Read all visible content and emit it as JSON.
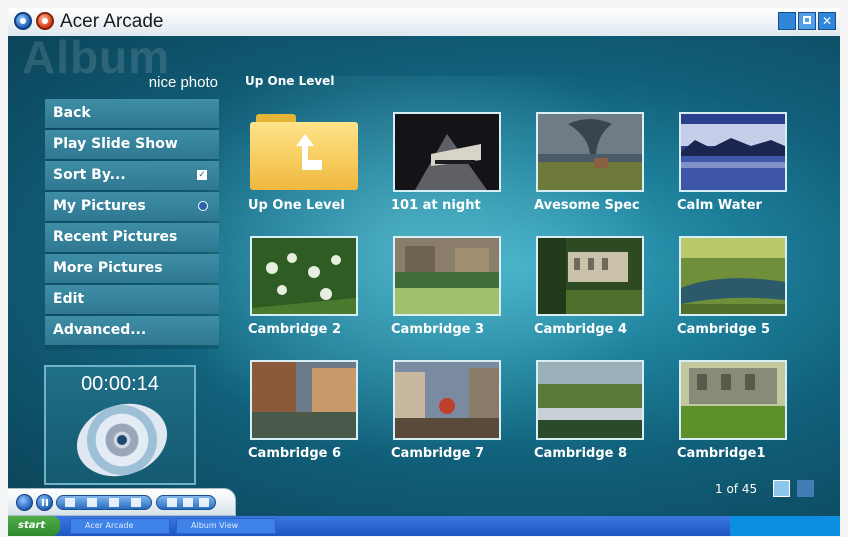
{
  "window": {
    "title": "Acer Arcade",
    "controls": [
      "minimize",
      "restore",
      "close"
    ]
  },
  "section_background_label": "Album",
  "album_name": "nice photo",
  "breadcrumb": "Up One Level",
  "menu": [
    {
      "label": "Back"
    },
    {
      "label": "Play Slide Show"
    },
    {
      "label": "Sort By...",
      "indicator": "checkbox"
    },
    {
      "label": "My Pictures",
      "indicator": "radio"
    },
    {
      "label": "Recent Pictures"
    },
    {
      "label": "More Pictures"
    },
    {
      "label": "Edit"
    },
    {
      "label": "Advanced..."
    }
  ],
  "player": {
    "time": "00:00:14"
  },
  "grid": [
    {
      "label": "Up One Level",
      "kind": "folder"
    },
    {
      "label": "101 at night",
      "kind": "photo",
      "colors": [
        "#1b1b22",
        "#6b6b70",
        "#d9d4c8"
      ]
    },
    {
      "label": "Avesome Spec",
      "kind": "photo",
      "colors": [
        "#4a5a66",
        "#8d9aa0",
        "#6d7a3c"
      ]
    },
    {
      "label": "Calm Water",
      "kind": "photo",
      "colors": [
        "#2b3f8c",
        "#c6cde8",
        "#2a3a6a"
      ]
    },
    {
      "label": "Cambridge 2",
      "kind": "photo",
      "colors": [
        "#2f5c22",
        "#e8eee0",
        "#4a7a2e"
      ]
    },
    {
      "label": "Cambridge 3",
      "kind": "photo",
      "colors": [
        "#8a7e6a",
        "#3f6e3a",
        "#b9c79a"
      ]
    },
    {
      "label": "Cambridge 4",
      "kind": "photo",
      "colors": [
        "#2d4a22",
        "#c9c2a8",
        "#4e6e2e"
      ]
    },
    {
      "label": "Cambridge 5",
      "kind": "photo",
      "colors": [
        "#6f8f3a",
        "#b8c86a",
        "#2d5a6a"
      ]
    },
    {
      "label": "Cambridge 6",
      "kind": "photo",
      "colors": [
        "#8a5a3a",
        "#6e7a8a",
        "#c89a6a"
      ]
    },
    {
      "label": "Cambridge 7",
      "kind": "photo",
      "colors": [
        "#7a8aa0",
        "#5a4a3a",
        "#c8b8a0"
      ]
    },
    {
      "label": "Cambridge 8",
      "kind": "photo",
      "colors": [
        "#5a7a3a",
        "#9ab0b8",
        "#2a4a2a"
      ]
    },
    {
      "label": "Cambridge1",
      "kind": "photo",
      "colors": [
        "#8a8a78",
        "#c2c8a0",
        "#5d8f2a"
      ]
    }
  ],
  "pager": {
    "text": "1 of 45"
  },
  "taskbar": {
    "start": "start",
    "tasks": [
      "Acer Arcade",
      "Album View"
    ]
  },
  "colors": {
    "stage_dark": "#0b4257",
    "stage_light": "#3aa7c0",
    "menu_item": "#3f8ea6",
    "title_accent": "#2f86d8"
  }
}
